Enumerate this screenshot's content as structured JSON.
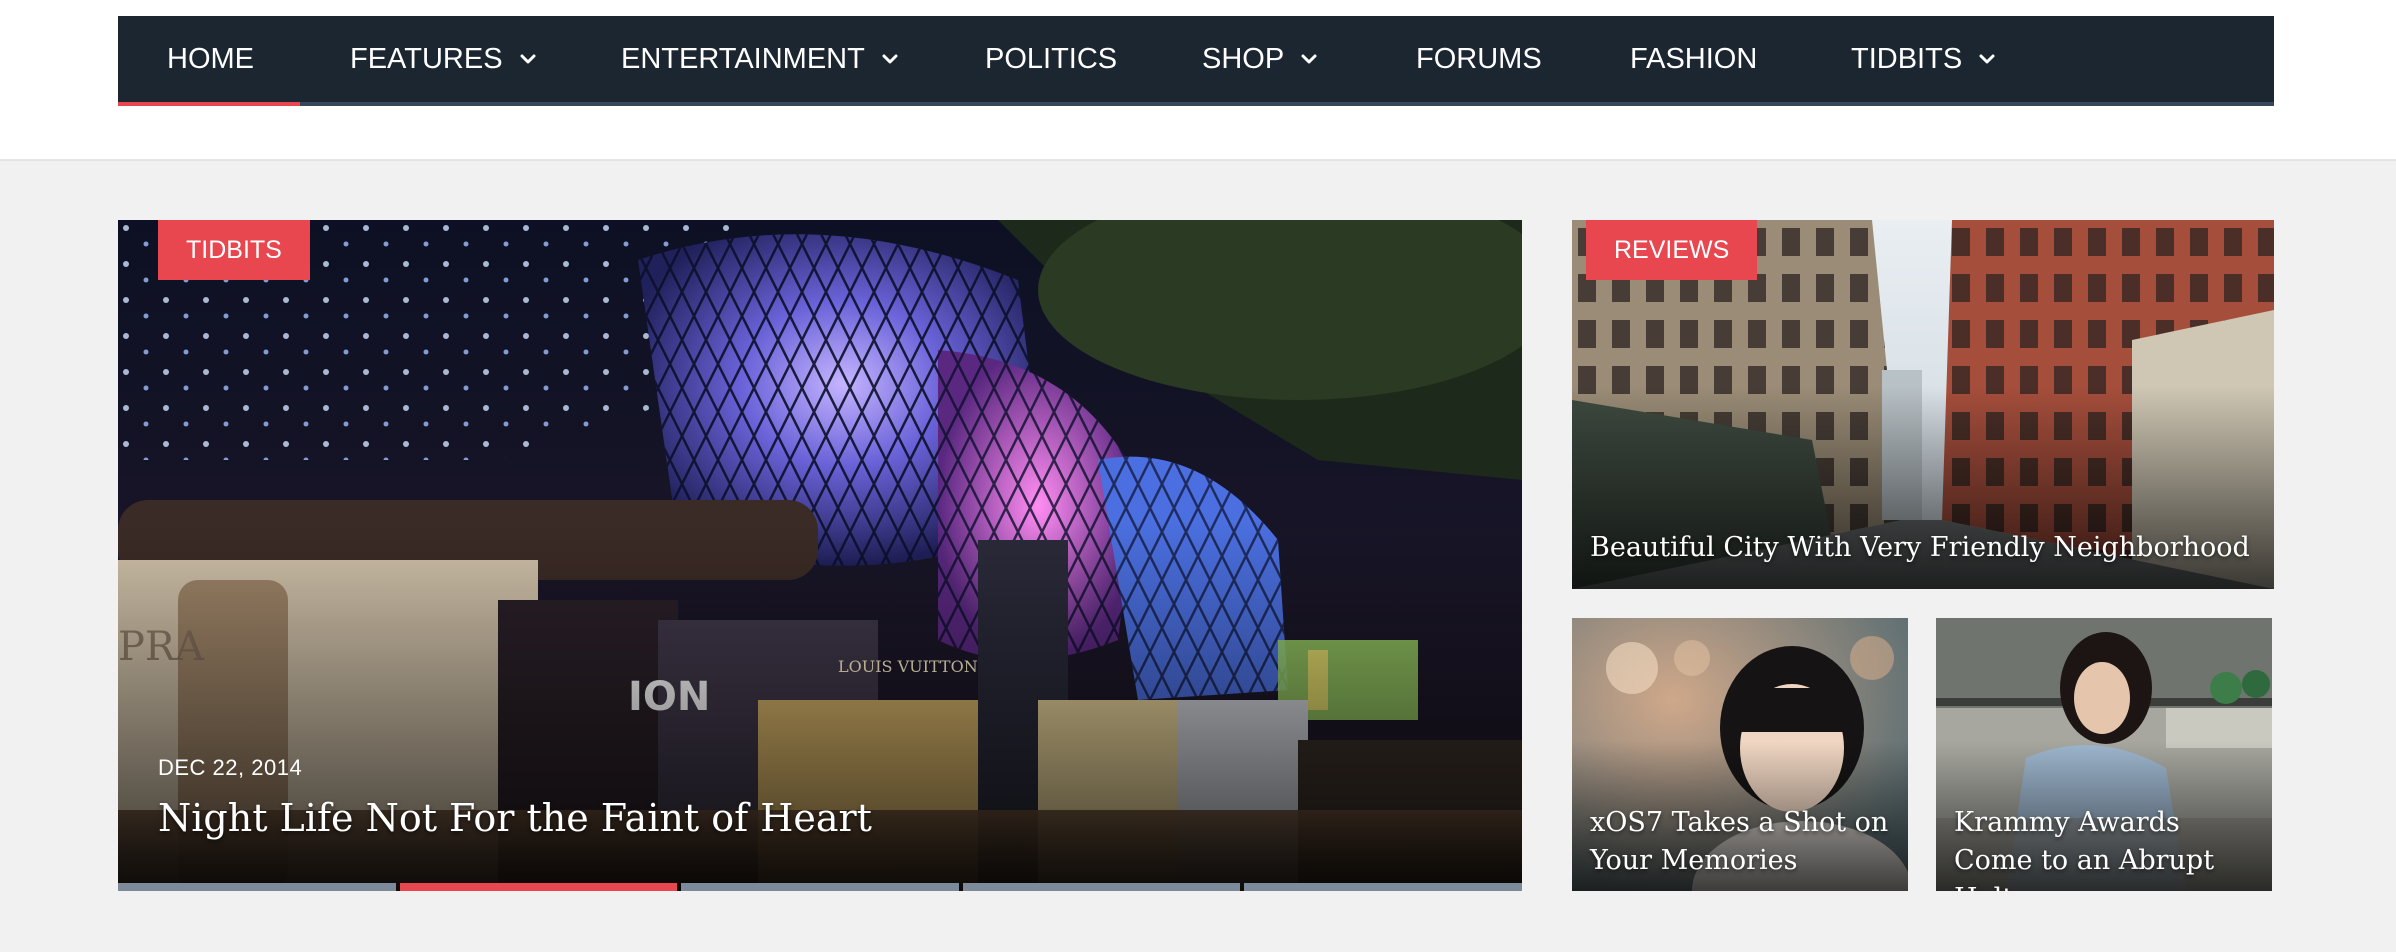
{
  "nav": {
    "items": [
      {
        "label": "HOME",
        "dropdown": false,
        "active": true
      },
      {
        "label": "FEATURES",
        "dropdown": true
      },
      {
        "label": "ENTERTAINMENT",
        "dropdown": true
      },
      {
        "label": "POLITICS",
        "dropdown": false
      },
      {
        "label": "SHOP",
        "dropdown": true
      },
      {
        "label": "FORUMS",
        "dropdown": false
      },
      {
        "label": "FASHION",
        "dropdown": false
      },
      {
        "label": "TIDBITS",
        "dropdown": true
      }
    ]
  },
  "featured": {
    "category": "TIDBITS",
    "date": "DEC 22, 2014",
    "title": "Night Life Not For the Faint of Heart",
    "slide_count": 5,
    "active_slide": 2
  },
  "side": {
    "top": {
      "category": "REVIEWS",
      "title": "Beautiful City With Very Friendly Neighborhood"
    },
    "bottom_left": {
      "title": "xOS7 Takes a Shot on Your Memories"
    },
    "bottom_right": {
      "title": "Krammy Awards Come to an Abrupt Halt"
    }
  },
  "colors": {
    "accent": "#e8474f",
    "nav_bg": "#1c2630",
    "page_bg": "#f1f1f1"
  }
}
